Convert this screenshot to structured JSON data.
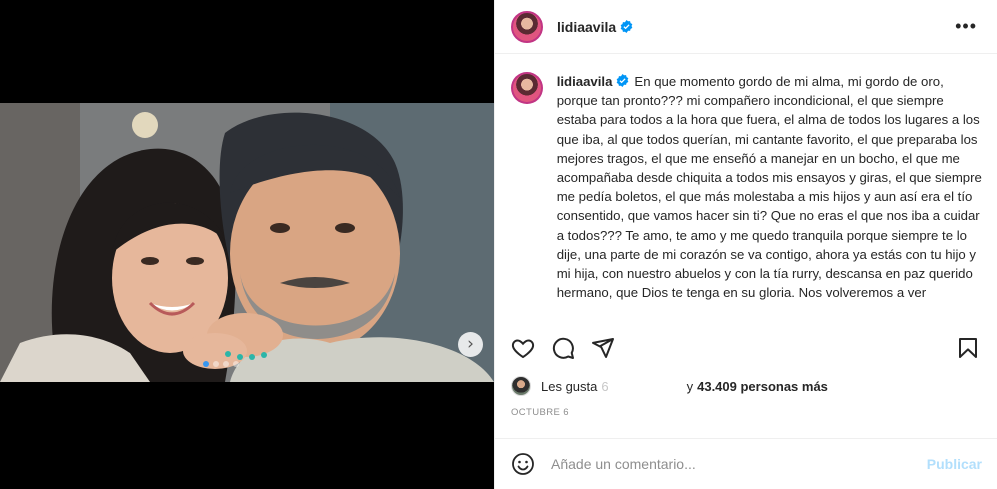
{
  "post": {
    "username": "lidiaavila",
    "more_label": "•••"
  },
  "media": {
    "carousel_dot_count": 4,
    "active_dot_index": 0,
    "next_label": "›"
  },
  "caption": {
    "username": "lidiaavila",
    "text": "En que momento gordo de mi alma, mi gordo de oro, porque tan pronto??? mi compañero incondicional, el que siempre estaba para todos a la hora que fuera, el alma de todos los lugares a los que iba, al que todos querían, mi cantante favorito, el que preparaba los mejores tragos, el que me enseñó a manejar en un bocho, el que me acompañaba desde chiquita a todos mis ensayos y giras, el que siempre me pedía boletos, el que más molestaba a mis hijos y aun así era el tío consentido, que vamos hacer sin ti? Que no eras el que nos iba a cuidar a todos??? Te amo, te amo y me quedo tranquila porque siempre te lo dije, una parte de mi corazón se va contigo, ahora ya estás con tu hijo y mi hija, con nuestro abuelos y con la tía rurry, descansa en paz querido hermano, que Dios te tenga en su gloria. Nos volveremos a ver"
  },
  "likes": {
    "prefix": "Les gusta",
    "liker_partial": "6",
    "joiner": "y",
    "count": "43.409 personas más"
  },
  "date": "OCTUBRE 6",
  "comment": {
    "placeholder": "Añade un comentario...",
    "publish_label": "Publicar"
  },
  "colors": {
    "verified": "#0095f6",
    "story_ring": "#c13584",
    "publish_disabled": "#b2dffc"
  },
  "icons": [
    "verified-badge-icon",
    "more-options-icon",
    "heart-icon",
    "comment-icon",
    "share-icon",
    "bookmark-icon",
    "emoji-icon",
    "chevron-right-icon"
  ]
}
